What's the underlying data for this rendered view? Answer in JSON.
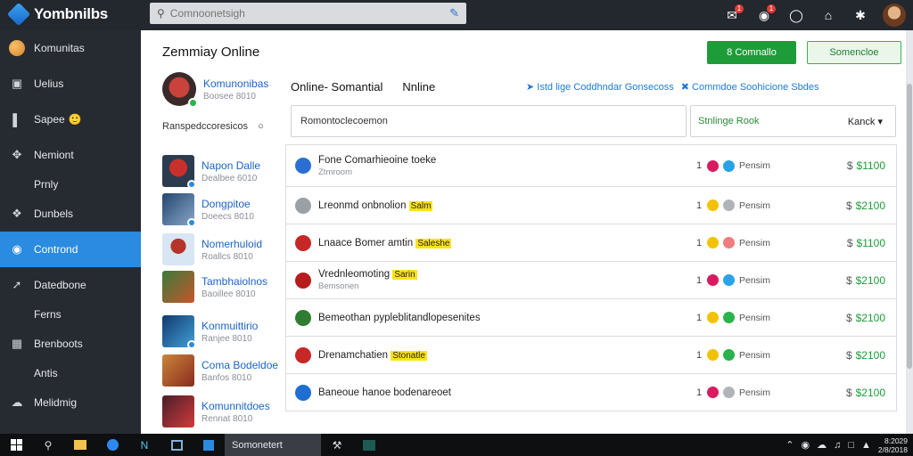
{
  "app": {
    "name": "Yombnilbs"
  },
  "search": {
    "placeholder": "Comnoonetsigh"
  },
  "topbar": {
    "badges": [
      "1",
      "1"
    ]
  },
  "sidebar": {
    "items": [
      {
        "label": "Komunitas",
        "icon": "globe-icon",
        "sub": false,
        "active": false
      },
      {
        "label": "Uelius",
        "icon": "inbox-icon",
        "sub": false,
        "active": false
      },
      {
        "label": "Sapee",
        "icon": "bar-chart-icon",
        "sub": false,
        "active": false,
        "emoji": "🙂"
      },
      {
        "label": "Nemiont",
        "icon": "network-icon",
        "sub": false,
        "active": false
      },
      {
        "label": "Prnly",
        "icon": "",
        "sub": true,
        "active": false
      },
      {
        "label": "Dunbels",
        "icon": "compass-icon",
        "sub": false,
        "active": false
      },
      {
        "label": "Contrond",
        "icon": "chat-icon",
        "sub": false,
        "active": true
      },
      {
        "label": "Datedbone",
        "icon": "arrow-icon",
        "sub": false,
        "active": false
      },
      {
        "label": "Ferns",
        "icon": "",
        "sub": true,
        "active": false
      },
      {
        "label": "Brenboots",
        "icon": "grid-icon",
        "sub": false,
        "active": false
      },
      {
        "label": "Antis",
        "icon": "",
        "sub": true,
        "active": false
      },
      {
        "label": "Melidmig",
        "icon": "cloud-icon",
        "sub": false,
        "active": false
      }
    ]
  },
  "main": {
    "title": "Zemmiay Online",
    "primary_button": "8 Comnallo",
    "outline_button": "Somencloe",
    "profile": {
      "name": "Komunonibas",
      "sub": "Boosee 8010"
    },
    "filter_label": "Ranspedccoresicos",
    "section_title_a": "Online-  Somantial",
    "section_title_b": "Nnline",
    "link_a": "Istd lige Coddhndar Gonsecoss",
    "link_b": "Commdoe Soohicione Sbdes",
    "room_input": "Romontoclecoemon",
    "status_value": "Stnlinge Rook",
    "sort_value": "Kanck",
    "friends": [
      {
        "name": "Napon Dalle",
        "sub": "Dealbee 6010"
      },
      {
        "name": "Dongpitoe",
        "sub": "Doeecs 8010"
      },
      {
        "name": "Nomerhuloid",
        "sub": "Roallcs 8010"
      },
      {
        "name": "Tambhaiolnos",
        "sub": "Baoillee 8010"
      },
      {
        "name": "Konmuittirio",
        "sub": "Ranjee 8010"
      },
      {
        "name": "Coma Bodeldoe",
        "sub": "Banfos 8010"
      },
      {
        "name": "Komunnitdoes",
        "sub": "Rennat 8010"
      }
    ],
    "rooms": [
      {
        "title": "Fone Comarhieoine toeke",
        "highlight": "",
        "sub": "Ztmroom",
        "num": "1",
        "status": "Pensim",
        "price": "$1100"
      },
      {
        "title": "Lreonmd onbnolion",
        "highlight": "Salm",
        "sub": "",
        "num": "1",
        "status": "Pensim",
        "price": "$2100"
      },
      {
        "title": "Lnaace Bomer amtin",
        "highlight": "Saleshe",
        "sub": "",
        "num": "1",
        "status": "Pensim",
        "price": "$1100"
      },
      {
        "title": "Vrednleomoting",
        "highlight": "Sarin",
        "sub": "Bemsonen",
        "num": "1",
        "status": "Pensim",
        "price": "$2100"
      },
      {
        "title": "Bemeothan pypleblitandlopesenites",
        "highlight": "",
        "sub": "",
        "num": "1",
        "status": "Pensim",
        "price": "$2100"
      },
      {
        "title": "Drenamchatien",
        "highlight": "Stonatle",
        "sub": "",
        "num": "1",
        "status": "Pensim",
        "price": "$2100"
      },
      {
        "title": "Baneoue hanoe bodenareoet",
        "highlight": "",
        "sub": "",
        "num": "1",
        "status": "Pensim",
        "price": "$2100"
      }
    ],
    "currency_mark": "$"
  },
  "taskbar": {
    "active_task": "Somonetert",
    "clock_line1": "8:2029",
    "clock_line2": "2/8/2018"
  }
}
